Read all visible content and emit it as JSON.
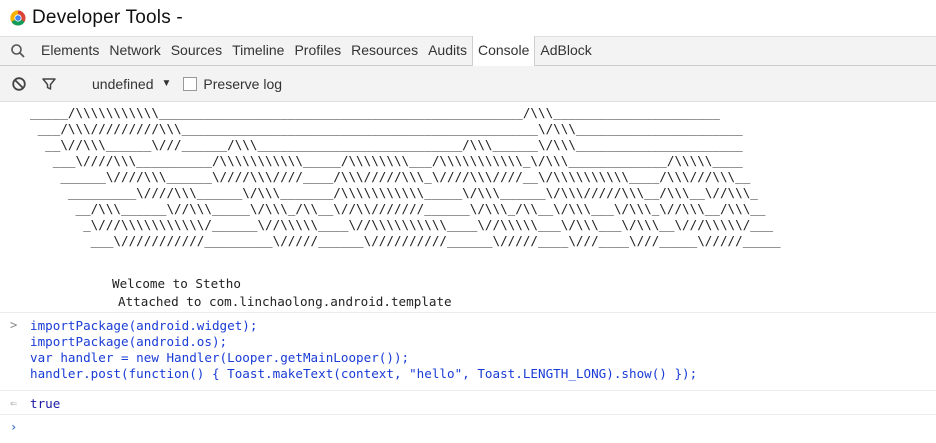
{
  "window": {
    "title": "Developer Tools -"
  },
  "tabs": [
    "Elements",
    "Network",
    "Sources",
    "Timeline",
    "Profiles",
    "Resources",
    "Audits",
    "Console",
    "AdBlock"
  ],
  "active_tab": "Console",
  "toolbar": {
    "context": "undefined",
    "preserve_log": "Preserve log"
  },
  "console": {
    "banner": "_____/\\\\\\\\\\\\\\\\\\\\\\________________________________________________/\\\\\\______________________\n ___/\\\\\\/////////\\\\\\_______________________________________________\\/\\\\\\______________________\n  __\\//\\\\\\______\\///______/\\\\\\___________________________/\\\\\\______\\/\\\\\\______________________\n   ___\\////\\\\\\__________/\\\\\\\\\\\\\\\\\\\\\\_____/\\\\\\\\\\\\\\\\___/\\\\\\\\\\\\\\\\\\\\\\_\\/\\\\\\_____________/\\\\\\\\\\____\n    ______\\////\\\\\\______\\////\\\\\\////____/\\\\\\/////\\\\\\_\\////\\\\\\////__\\/\\\\\\\\\\\\\\\\\\\\____/\\\\\\///\\\\\\__\n     _________\\////\\\\\\______\\/\\\\\\_______/\\\\\\\\\\\\\\\\\\\\\\_____\\/\\\\\\______\\/\\\\\\/////\\\\\\__/\\\\\\__\\//\\\\\\_\n      __/\\\\\\______\\//\\\\\\_____\\/\\\\\\_/\\\\__\\//\\\\///////______\\/\\\\\\_/\\\\__\\/\\\\\\___\\/\\\\\\_\\//\\\\\\__/\\\\\\__\n       _\\///\\\\\\\\\\\\\\\\\\\\\\/______\\//\\\\\\\\\\____\\//\\\\\\\\\\\\\\\\\\\\____\\//\\\\\\\\\\___\\/\\\\\\___\\/\\\\\\__\\///\\\\\\\\\\/___\n        ___\\///////////_________\\/////______\\//////////______\\/////____\\///____\\///_____\\/////_____",
    "welcome": "Welcome to Stetho",
    "attached": "Attached to com.linchaolong.android.template",
    "input_lines": [
      "importPackage(android.widget);",
      "importPackage(android.os);",
      "var handler = new Handler(Looper.getMainLooper());",
      "handler.post(function() { Toast.makeText(context, \"hello\", Toast.LENGTH_LONG).show() });"
    ],
    "result": "true"
  },
  "colors": {
    "code": "#1a3cd6",
    "prompt": "#3e76c6",
    "result": "#1a1aa6"
  }
}
